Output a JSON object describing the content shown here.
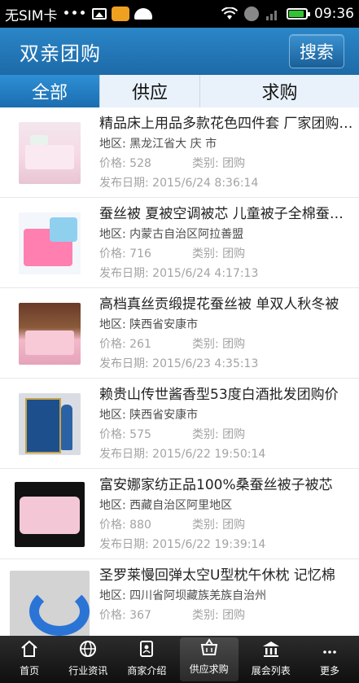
{
  "status_bar": {
    "carrier": "无SIM卡",
    "dots": "•••",
    "time": "09:36"
  },
  "header": {
    "title": "双亲团购",
    "search_label": "搜索"
  },
  "tabs": [
    {
      "label": "全部",
      "active": true
    },
    {
      "label": "供应",
      "active": false
    },
    {
      "label": "求购",
      "active": false
    }
  ],
  "field_labels": {
    "region": "地区:",
    "price": "价格:",
    "category": "类别:",
    "date": "发布日期:"
  },
  "items": [
    {
      "title": "精品床上用品多款花色四件套 厂家团购价 四件套批发",
      "region": "黑龙江省大 庆 市",
      "price": "528",
      "category": "团购",
      "date": "2015/6/24 8:36:14",
      "thumb": "bedding-set"
    },
    {
      "title": "蚕丝被 夏被空调被芯 儿童被子全棉蚕丝被",
      "region": "内蒙古自治区阿拉善盟",
      "price": "716",
      "category": "团购",
      "date": "2015/6/24 4:17:13",
      "thumb": "silk-quilt"
    },
    {
      "title": "高档真丝贡缎提花蚕丝被 单双人秋冬被",
      "region": "陕西省安康市",
      "price": "261",
      "category": "团购",
      "date": "2015/6/23 4:35:13",
      "thumb": "bedroom-set"
    },
    {
      "title": "赖贵山传世酱香型53度白酒批发团购价",
      "region": "陕西省安康市",
      "price": "575",
      "category": "团购",
      "date": "2015/6/22 19:50:14",
      "thumb": "liquor-box"
    },
    {
      "title": "富安娜家纺正品100%桑蚕丝被子被芯",
      "region": "西藏自治区阿里地区",
      "price": "880",
      "category": "团购",
      "date": "2015/6/22 19:39:14",
      "thumb": "pink-quilt"
    },
    {
      "title": "圣罗莱慢回弹太空U型枕午休枕 记忆棉",
      "region": "四川省阿坝藏族羌族自治州",
      "price": "367",
      "category": "团购",
      "date": "",
      "thumb": "u-pillow"
    }
  ],
  "bottom_nav": [
    {
      "label": "首页",
      "icon": "home-icon",
      "active": false
    },
    {
      "label": "行业资讯",
      "icon": "globe-icon",
      "active": false
    },
    {
      "label": "商家介绍",
      "icon": "contacts-icon",
      "active": false
    },
    {
      "label": "供应求购",
      "icon": "basket-icon",
      "active": true
    },
    {
      "label": "展会列表",
      "icon": "building-icon",
      "active": false
    },
    {
      "label": "更多",
      "icon": "more-icon",
      "active": false
    }
  ]
}
